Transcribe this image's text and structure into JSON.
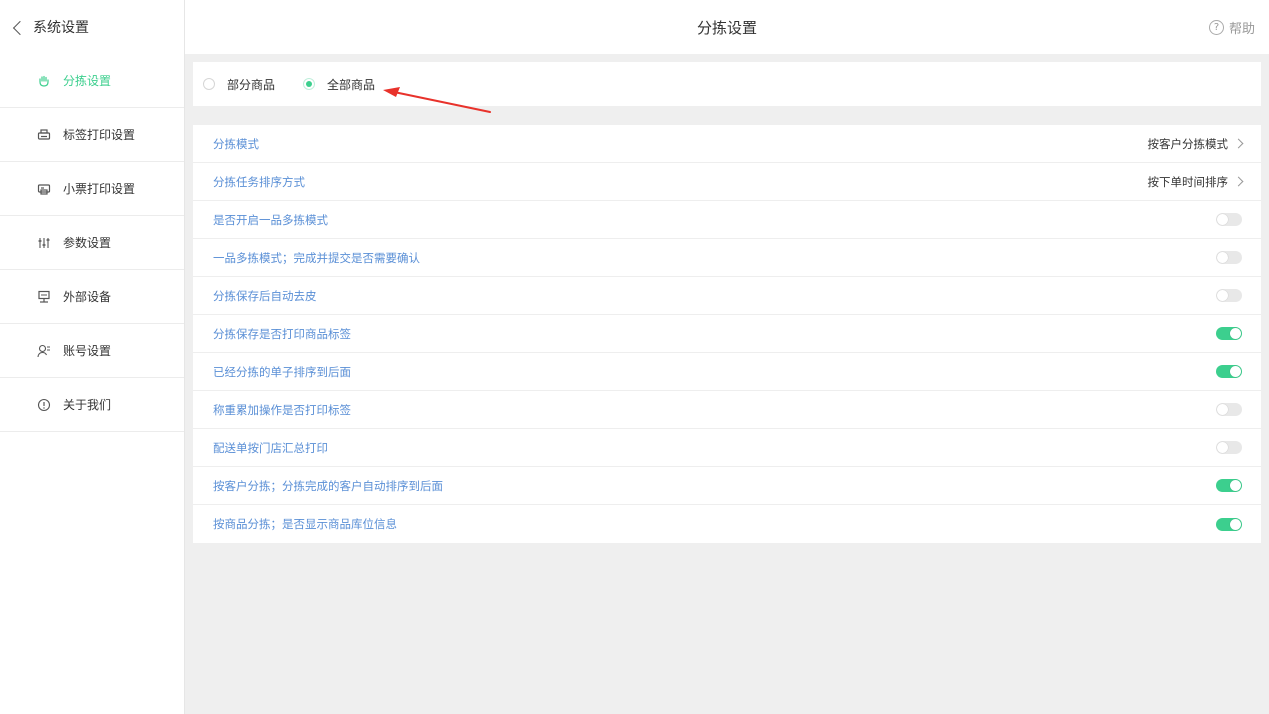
{
  "header": {
    "back_label": "系统设置",
    "title": "分拣设置",
    "help_label": "帮助",
    "help_icon": "question-circle-icon"
  },
  "sidebar": {
    "items": [
      {
        "label": "分拣设置",
        "icon": "hand-icon",
        "active": true
      },
      {
        "label": "标签打印设置",
        "icon": "printer-icon",
        "active": false
      },
      {
        "label": "小票打印设置",
        "icon": "receipt-printer-icon",
        "active": false
      },
      {
        "label": "参数设置",
        "icon": "sliders-icon",
        "active": false
      },
      {
        "label": "外部设备",
        "icon": "device-icon",
        "active": false
      },
      {
        "label": "账号设置",
        "icon": "user-icon",
        "active": false
      },
      {
        "label": "关于我们",
        "icon": "info-icon",
        "active": false
      }
    ]
  },
  "scope": {
    "options": [
      {
        "label": "部分商品",
        "checked": false
      },
      {
        "label": "全部商品",
        "checked": true
      }
    ]
  },
  "settings": {
    "rows": [
      {
        "label": "分拣模式",
        "type": "select",
        "value": "按客户分拣模式"
      },
      {
        "label": "分拣任务排序方式",
        "type": "select",
        "value": "按下单时间排序"
      },
      {
        "label": "是否开启一品多拣模式",
        "type": "toggle",
        "on": false
      },
      {
        "label": "一品多拣模式；完成并提交是否需要确认",
        "type": "toggle",
        "on": false
      },
      {
        "label": "分拣保存后自动去皮",
        "type": "toggle",
        "on": false
      },
      {
        "label": "分拣保存是否打印商品标签",
        "type": "toggle",
        "on": true
      },
      {
        "label": "已经分拣的单子排序到后面",
        "type": "toggle",
        "on": true
      },
      {
        "label": "称重累加操作是否打印标签",
        "type": "toggle",
        "on": false
      },
      {
        "label": "配送单按门店汇总打印",
        "type": "toggle",
        "on": false
      },
      {
        "label": "按客户分拣；分拣完成的客户自动排序到后面",
        "type": "toggle",
        "on": true
      },
      {
        "label": "按商品分拣；是否显示商品库位信息",
        "type": "toggle",
        "on": true
      }
    ]
  },
  "colors": {
    "accent": "#3ccf8e",
    "label_blue": "#5a8fd6",
    "annotation_red": "#e8322b"
  }
}
